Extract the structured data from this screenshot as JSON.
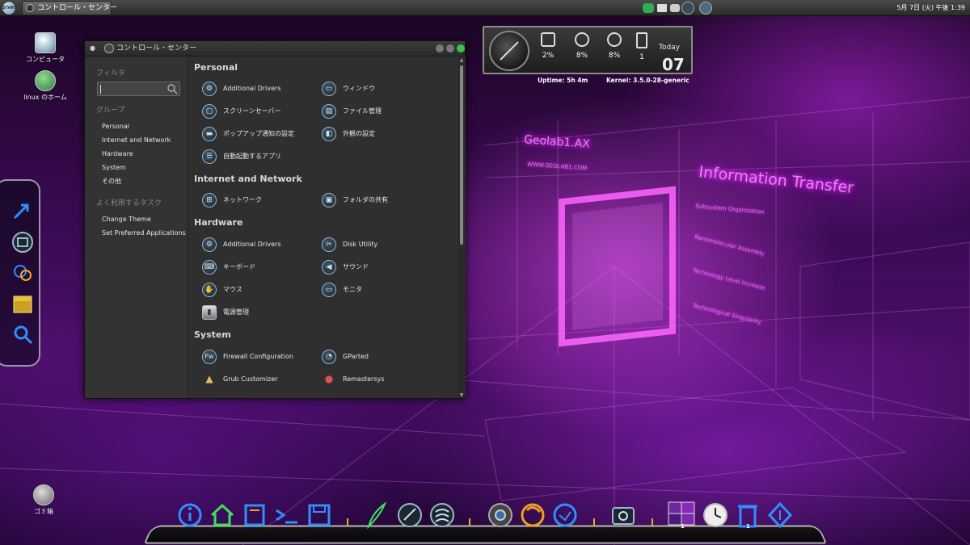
{
  "top_panel": {
    "start_label": "START",
    "taskbar_item": "コントロール・センター",
    "clock": "5月 7日 (火) 午後 1:39"
  },
  "desktop_icons": [
    "コンピュータ",
    "linux のホーム",
    "ゴミ箱"
  ],
  "sysmon": {
    "stats": [
      "2%",
      "8%",
      "8%",
      "1"
    ],
    "today_label": "Today",
    "day": "07",
    "uptime": "Uptime:  5h 4m",
    "kernel": "Kernel: 3.5.0-28-generic"
  },
  "wallpaper": {
    "title1": "Geolab1.AX",
    "title2": "Information Transfer",
    "small": [
      "Subsystem Organization",
      "Nanomolecular Assembly",
      "Technology Level Increase",
      "Technological Singularity",
      "WWW.GEOLAB1.COM"
    ]
  },
  "window": {
    "title": "コントロール・センター",
    "sidebar": {
      "filter_heading": "フィルタ",
      "group_heading": "グループ",
      "groups": [
        "Personal",
        "Internet and Network",
        "Hardware",
        "System",
        "その他"
      ],
      "tasks_heading": "よく利用するタスク",
      "tasks": [
        "Change Theme",
        "Set Preferred Applications"
      ]
    },
    "sections": [
      {
        "title": "Personal",
        "items": [
          "Additional Drivers",
          "ウィンドウ",
          "スクリーンセーバー",
          "ファイル管理",
          "ポップアップ通知の設定",
          "外観の設定",
          "自動起動するアプリ"
        ]
      },
      {
        "title": "Internet and Network",
        "items": [
          "ネットワーク",
          "フォルダの共有"
        ]
      },
      {
        "title": "Hardware",
        "items": [
          "Additional Drivers",
          "Disk Utility",
          "キーボード",
          "サウンド",
          "マウス",
          "モニタ",
          "電源管理"
        ]
      },
      {
        "title": "System",
        "items": [
          "Firewall Configuration",
          "GParted",
          "Grub Customizer",
          "Remastersys"
        ]
      }
    ]
  },
  "dock": {
    "badges": [
      "1",
      "1"
    ],
    "icons": [
      "info-icon",
      "home-icon",
      "file-manager-icon",
      "terminal-icon",
      "save-icon",
      "feather-icon",
      "text-editor-icon",
      "music-icon",
      "chrome-icon",
      "firefox-icon",
      "thunderbird-icon",
      "screenshot-icon",
      "workspace-switcher-icon",
      "clock-icon",
      "trash-icon",
      "ubuntu-icon"
    ]
  },
  "colors": {
    "accent_icon": "#9fb7cc",
    "dock_neon_blue": "#2f8fff",
    "wallpaper_neon": "#f07bff"
  }
}
